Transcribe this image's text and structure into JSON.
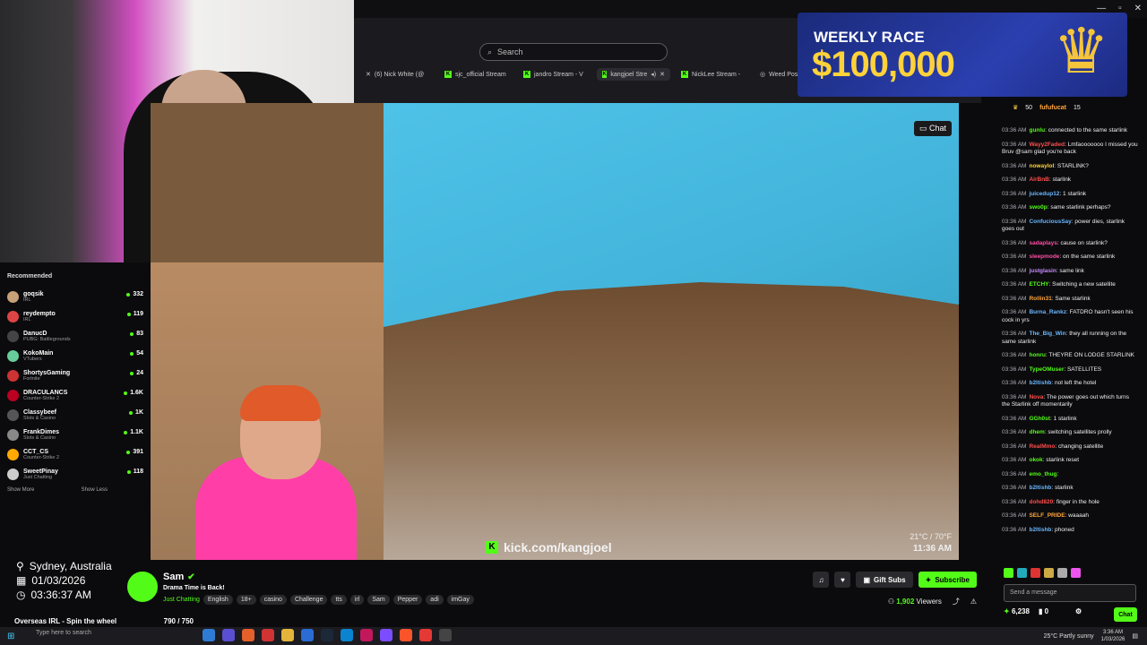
{
  "browser": {
    "search_placeholder": "Search",
    "tabs": [
      {
        "label": "(6) Nick White (@",
        "icon": "x-icon"
      },
      {
        "label": "sjc_official Stream",
        "icon": "kick-icon"
      },
      {
        "label": "jandro Stream - V",
        "icon": "kick-icon"
      },
      {
        "label": "kangjoel Stre",
        "icon": "kick-icon"
      },
      {
        "label": "NickLee Stream -",
        "icon": "kick-icon"
      },
      {
        "label": "Weed Possession",
        "icon": "page-icon"
      }
    ]
  },
  "ad": {
    "line1": "WEEKLY RACE",
    "line2": "$100,000"
  },
  "video": {
    "chat_toggle": "Chat",
    "watermark": "kick.com/kangjoel",
    "weather": "21°C / 70°F",
    "time": "11:36 AM"
  },
  "sidebar": {
    "title": "Recommended",
    "items": [
      {
        "name": "goqsik",
        "category": "IRL",
        "viewers": "332",
        "color": "#c8a078"
      },
      {
        "name": "reydempto",
        "category": "IRL",
        "viewers": "119",
        "color": "#d44"
      },
      {
        "name": "DanucD",
        "category": "PUBG: Battlegrounds",
        "viewers": "83",
        "color": "#444"
      },
      {
        "name": "KokoMain",
        "category": "VTubers",
        "viewers": "54",
        "color": "#6c9"
      },
      {
        "name": "ShortysGaming",
        "category": "Fortnite",
        "viewers": "24",
        "color": "#c33"
      },
      {
        "name": "DRACULANCS",
        "category": "Counter-Strike 2",
        "viewers": "1.6K",
        "color": "#b02"
      },
      {
        "name": "Classybeef",
        "category": "Slots & Casino",
        "viewers": "1K",
        "color": "#555"
      },
      {
        "name": "FrankDimes",
        "category": "Slots & Casino",
        "viewers": "1.1K",
        "color": "#888"
      },
      {
        "name": "CCT_CS",
        "category": "Counter-Strike 2",
        "viewers": "391",
        "color": "#fa0"
      },
      {
        "name": "SweetPinay",
        "category": "Just Chatting",
        "viewers": "118",
        "color": "#ccc"
      }
    ],
    "show_more": "Show More",
    "show_less": "Show Less"
  },
  "location": {
    "city": "Sydney, Australia",
    "date": "01/03/2026",
    "time": "03:36:37 AM"
  },
  "goal": {
    "label": "Overseas IRL - Spin the wheel",
    "count": "790 / 750",
    "progress": 1.0
  },
  "stream": {
    "name": "Sam",
    "title": "Drama Time is Back!",
    "category": "Just Chatting",
    "tags": [
      "English",
      "18+",
      "casino",
      "Challenge",
      "tts",
      "irl",
      "Sam",
      "Pepper",
      "adi",
      "imGay"
    ],
    "gift_label": "Gift Subs",
    "subscribe_label": "Subscribe",
    "viewers": "1,902",
    "viewers_label": "Viewers"
  },
  "chat": {
    "header_user1": "fufufucat",
    "header_count1": "50",
    "header_count2": "15",
    "messages": [
      {
        "ts": "03:36 AM",
        "user": "gunlu",
        "color": "#53fc18",
        "text": ": connected to the same starlink"
      },
      {
        "ts": "03:36 AM",
        "user": "Wayy2Faded",
        "color": "#ff4d4d",
        "text": ": Lmfaooooooo I missed you Bruv @sam glad you're back"
      },
      {
        "ts": "03:36 AM",
        "user": "nowaylol",
        "color": "#ffd23a",
        "text": ": STARLINK?"
      },
      {
        "ts": "03:36 AM",
        "user": "AirBnB",
        "color": "#ff4d4d",
        "text": ": starlink"
      },
      {
        "ts": "03:36 AM",
        "user": "juicedup12",
        "color": "#6ab7ff",
        "text": ": 1 starlink"
      },
      {
        "ts": "03:36 AM",
        "user": "swo0p",
        "color": "#53fc18",
        "text": ": same starlink perhaps?"
      },
      {
        "ts": "03:36 AM",
        "user": "ConfuciousSay",
        "color": "#6ab7ff",
        "text": ": power dies, starlink goes out"
      },
      {
        "ts": "03:36 AM",
        "user": "sadaplays",
        "color": "#ff4da6",
        "text": ": cause on starlink?"
      },
      {
        "ts": "03:36 AM",
        "user": "sleepmode",
        "color": "#ff4da6",
        "text": ": on the same starlink"
      },
      {
        "ts": "03:36 AM",
        "user": "justglasin",
        "color": "#c78bff",
        "text": ": same link"
      },
      {
        "ts": "03:36 AM",
        "user": "ETCHY",
        "color": "#53fc18",
        "text": ": Switching a new satellite"
      },
      {
        "ts": "03:36 AM",
        "user": "Rollin31",
        "color": "#ffa53a",
        "text": ": Same starlink"
      },
      {
        "ts": "03:36 AM",
        "user": "Burna_Rankz",
        "color": "#6ab7ff",
        "text": ": FATDRO hasn't seen his cock in yrs"
      },
      {
        "ts": "03:36 AM",
        "user": "The_Big_Win",
        "color": "#6ab7ff",
        "text": ": they all running on the same starlink"
      },
      {
        "ts": "03:36 AM",
        "user": "honru",
        "color": "#53fc18",
        "text": ": THEYRE ON LODGE STARLINK"
      },
      {
        "ts": "03:36 AM",
        "user": "TypeOMuser",
        "color": "#53fc18",
        "text": ": SATELLITES"
      },
      {
        "ts": "03:36 AM",
        "user": "b2ltishb",
        "color": "#6ab7ff",
        "text": ": not left the hotel"
      },
      {
        "ts": "03:36 AM",
        "user": "Nova",
        "color": "#ff4d4d",
        "text": ": The power goes out which turns the Starlink off momentarily"
      },
      {
        "ts": "03:36 AM",
        "user": "GGh0st",
        "color": "#53fc18",
        "text": ": 1 starlink"
      },
      {
        "ts": "03:36 AM",
        "user": "dhem",
        "color": "#53fc18",
        "text": ": switching satellites prolly"
      },
      {
        "ts": "03:36 AM",
        "user": "RealMmo",
        "color": "#ff4d4d",
        "text": ": changing satellite"
      },
      {
        "ts": "03:36 AM",
        "user": "okok",
        "color": "#53fc18",
        "text": ": starlink reset"
      },
      {
        "ts": "03:36 AM",
        "user": "emo_thug",
        "color": "#53fc18",
        "text": ":"
      },
      {
        "ts": "03:36 AM",
        "user": "b2ltishb",
        "color": "#6ab7ff",
        "text": ": starlink"
      },
      {
        "ts": "03:36 AM",
        "user": "dohd820",
        "color": "#ff4d4d",
        "text": ": finger in the hole"
      },
      {
        "ts": "03:36 AM",
        "user": "SELF_PRIDE",
        "color": "#ffa53a",
        "text": ": waaaah"
      },
      {
        "ts": "03:36 AM",
        "user": "b2ltishb",
        "color": "#6ab7ff",
        "text": ": phoned"
      }
    ],
    "input_placeholder": "Send a message",
    "points": "6,238",
    "other_count": "0",
    "send_label": "Chat"
  },
  "taskbar": {
    "search_placeholder": "Type here to search",
    "weather": "25°C  Partly sunny",
    "clock_time": "3:36 AM",
    "clock_date": "1/03/2026"
  }
}
